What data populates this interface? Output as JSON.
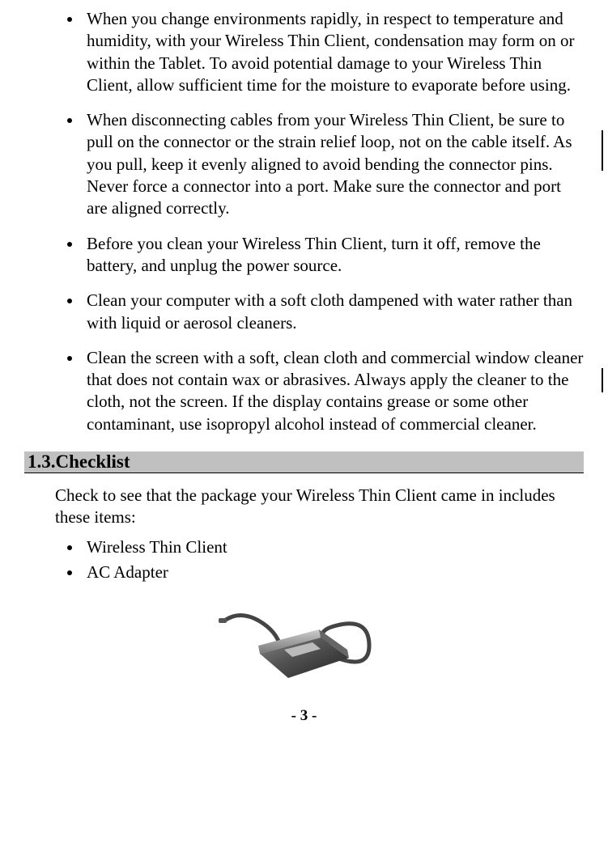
{
  "bullets_top": [
    "When you change environments rapidly, in respect to temperature and humidity, with your Wireless Thin Client, condensation may form on or within the Tablet. To avoid potential damage to your Wireless Thin Client, allow sufficient time for the moisture to evaporate before using.",
    "When disconnecting cables from your Wireless Thin Client, be sure to pull on the connector or the strain relief loop, not on the cable itself.  As you pull, keep it evenly aligned to avoid bending the connector pins.  Never force a connector into a port.  Make sure the connector and port are aligned correctly.",
    "Before you clean your Wireless Thin Client, turn it off, remove the battery, and unplug the power source.",
    "Clean your computer with a soft cloth dampened with water rather than with liquid or aerosol cleaners.",
    "Clean the screen with a soft, clean cloth and commercial window cleaner that does not contain wax or abrasives.  Always apply the cleaner to the cloth, not the screen. If the display contains grease or some other contaminant, use isopropyl alcohol instead of commercial cleaner."
  ],
  "section": {
    "number": "1.3.",
    "title": "Checklist"
  },
  "intro": "Check to see that the package your Wireless Thin Client came in includes these items:",
  "items": [
    "Wireless Thin Client",
    "AC Adapter"
  ],
  "footer": "- 3 -"
}
